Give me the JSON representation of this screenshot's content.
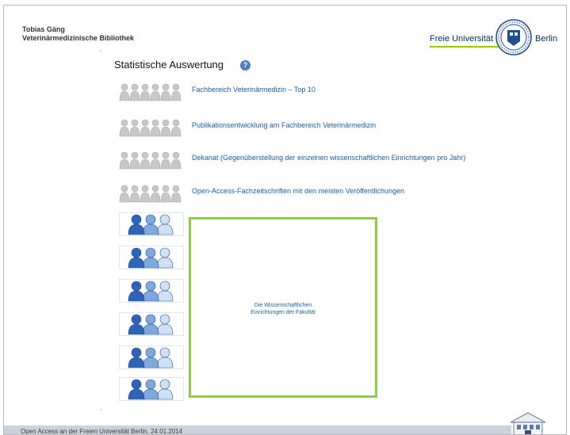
{
  "header": {
    "author_name": "Tobias Gäng",
    "author_affiliation": "Veterinärmedizinische Bibliothek",
    "logo_left": "Freie Universität",
    "logo_right": "Berlin"
  },
  "section": {
    "title": "Statistische Auswertung",
    "help_symbol": "?"
  },
  "links": [
    {
      "label": "Fachbereich Veterinärmedizin – Top 10"
    },
    {
      "label": "Publikationsentwicklung am Fachbereich Veterinärmedizin"
    },
    {
      "label": "Dekanat (Gegenüberstellung der einzelnen wissenschaftlichen Einrichtungen pro Jahr)"
    },
    {
      "label": "Open-Access-Fachzeitschriften mit den meisten Veröffentlichungen"
    }
  ],
  "box": {
    "line1": "Die Wissenschaftlichen",
    "line2": "Einrichtungen der Fakultät"
  },
  "footer": {
    "text": "Open Access an der Freien Universität Berlin, 24.01.2014"
  },
  "colors": {
    "accent_green": "#8fcc45",
    "link_blue": "#1a5fa6",
    "footer_bg": "#c9d3de"
  }
}
